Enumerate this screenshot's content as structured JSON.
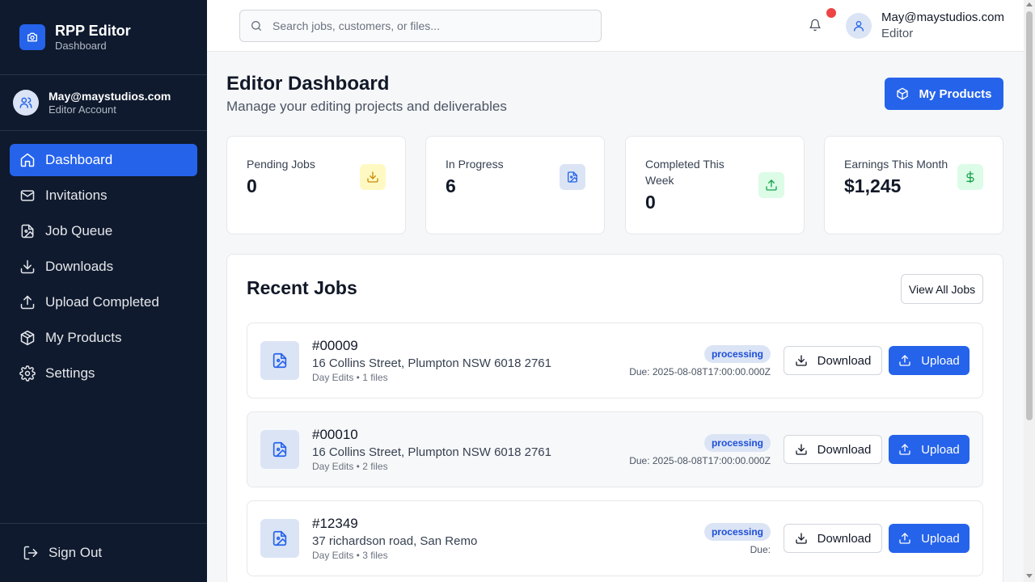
{
  "brand": {
    "title": "RPP Editor",
    "subtitle": "Dashboard"
  },
  "account": {
    "name": "May@maystudios.com",
    "role": "Editor Account"
  },
  "nav": [
    {
      "label": "Dashboard",
      "icon": "home-icon",
      "active": true
    },
    {
      "label": "Invitations",
      "icon": "mail-icon"
    },
    {
      "label": "Job Queue",
      "icon": "file-image-icon"
    },
    {
      "label": "Downloads",
      "icon": "download-icon"
    },
    {
      "label": "Upload Completed",
      "icon": "upload-icon"
    },
    {
      "label": "My Products",
      "icon": "package-icon"
    },
    {
      "label": "Settings",
      "icon": "gear-icon"
    }
  ],
  "sign_out": "Sign Out",
  "header": {
    "search_placeholder": "Search jobs, customers, or files...",
    "user_name": "May@maystudios.com",
    "user_role": "Editor"
  },
  "page": {
    "title": "Editor Dashboard",
    "subtitle": "Manage your editing projects and deliverables",
    "my_products_label": "My Products"
  },
  "stats": [
    {
      "label": "Pending Jobs",
      "value": "0",
      "icon": "download-icon",
      "color": "#ca8a04",
      "bg": "#fef9c3"
    },
    {
      "label": "In Progress",
      "value": "6",
      "icon": "file-image-icon",
      "color": "#2563eb",
      "bg": "#dbe4f5"
    },
    {
      "label": "Completed This Week",
      "value": "0",
      "icon": "upload-icon",
      "color": "#16a34a",
      "bg": "#dcfce7"
    },
    {
      "label": "Earnings This Month",
      "value": "$1,245",
      "icon": "dollar-icon",
      "color": "#16a34a",
      "bg": "#dcfce7"
    }
  ],
  "recent": {
    "title": "Recent Jobs",
    "view_all_label": "View All Jobs",
    "download_label": "Download",
    "upload_label": "Upload",
    "jobs": [
      {
        "id": "#00009",
        "address": "16 Collins Street, Plumpton NSW 6018 2761",
        "meta": "Day Edits • 1 files",
        "status": "processing",
        "due": "Due: 2025-08-08T17:00:00.000Z"
      },
      {
        "id": "#00010",
        "address": "16 Collins Street, Plumpton NSW 6018 2761",
        "meta": "Day Edits • 2 files",
        "status": "processing",
        "due": "Due: 2025-08-08T17:00:00.000Z"
      },
      {
        "id": "#12349",
        "address": "37 richardson road, San Remo",
        "meta": "Day Edits • 3 files",
        "status": "processing",
        "due": "Due:"
      }
    ]
  },
  "colors": {
    "sidebar_bg": "#0f1a2e",
    "accent": "#2563eb",
    "notification_dot": "#ef4444"
  }
}
